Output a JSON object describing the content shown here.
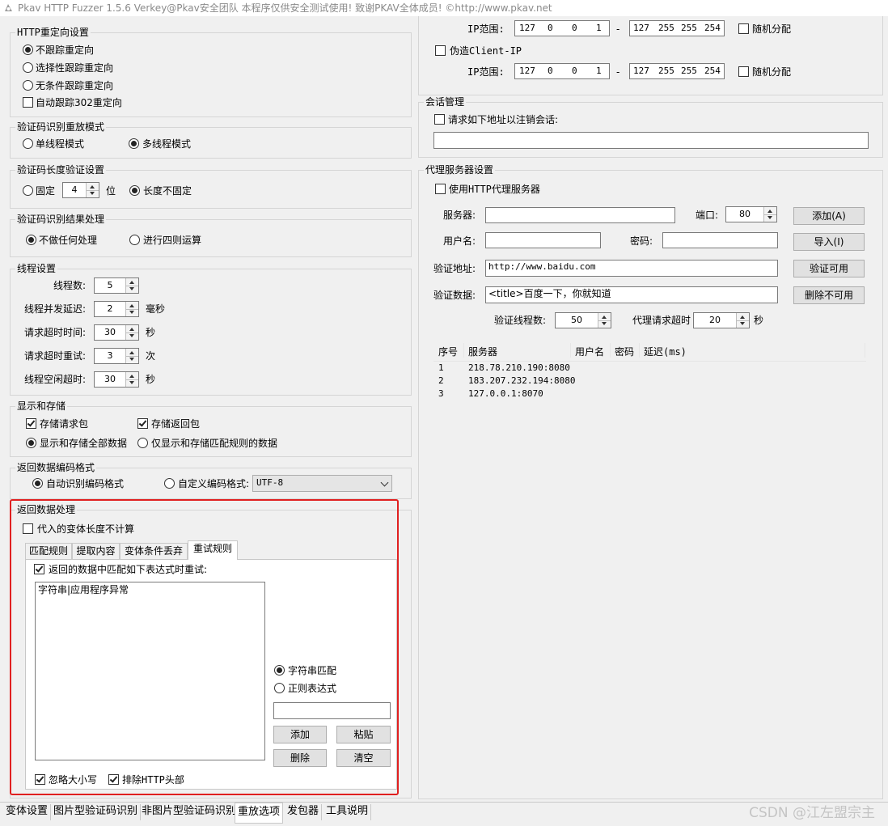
{
  "title_bar": {
    "text": "Pkav HTTP Fuzzer 1.5.6  Verkey@Pkav安全团队  本程序仅供安全测试使用! 致谢PKAV全体成员! ©http://www.pkav.net"
  },
  "redirect": {
    "group_label": "HTTP重定向设置",
    "options": [
      "不跟踪重定向",
      "选择性跟踪重定向",
      "无条件跟踪重定向"
    ],
    "auto302": "自动跟踪302重定向"
  },
  "captcha_replay": {
    "group_label": "验证码识别重放模式",
    "single": "单线程模式",
    "multi": "多线程模式"
  },
  "captcha_length": {
    "group_label": "验证码长度验证设置",
    "fixed": "固定",
    "value": "4",
    "unit": "位",
    "variable": "长度不固定"
  },
  "captcha_result": {
    "group_label": "验证码识别结果处理",
    "none": "不做任何处理",
    "arith": "进行四则运算"
  },
  "threads": {
    "group_label": "线程设置",
    "rows": [
      {
        "label": "线程数:",
        "value": "5",
        "unit": ""
      },
      {
        "label": "线程并发延迟:",
        "value": "2",
        "unit": "毫秒"
      },
      {
        "label": "请求超时时间:",
        "value": "30",
        "unit": "秒"
      },
      {
        "label": "请求超时重试:",
        "value": "3",
        "unit": "次"
      },
      {
        "label": "线程空闲超时:",
        "value": "30",
        "unit": "秒"
      }
    ]
  },
  "display": {
    "group_label": "显示和存储",
    "store_req": "存储请求包",
    "store_resp": "存储返回包",
    "show_all": "显示和存储全部数据",
    "show_match": "仅显示和存储匹配规则的数据"
  },
  "encoding": {
    "group_label": "返回数据编码格式",
    "auto": "自动识别编码格式",
    "custom": "自定义编码格式:",
    "selected": "UTF-8"
  },
  "response": {
    "group_label": "返回数据处理",
    "ignore_len": "代入的变体长度不计算",
    "tabs": [
      "匹配规则",
      "提取内容",
      "变体条件丢弃",
      "重试规则"
    ],
    "retry_check": "返回的数据中匹配如下表达式时重试:",
    "list_item": "字符串|应用程序异常",
    "mode_string": "字符串匹配",
    "mode_regex": "正则表达式",
    "input_value": "",
    "btn_add": "添加",
    "btn_paste": "粘贴",
    "btn_delete": "删除",
    "btn_clear": "清空",
    "ignore_case": "忽略大小写",
    "exclude_header": "排除HTTP头部"
  },
  "ip": {
    "label": "IP范围:",
    "row1": {
      "from": [
        "127",
        "0",
        "0",
        "1"
      ],
      "to": [
        "127",
        "255",
        "255",
        "254"
      ]
    },
    "row2": {
      "from": [
        "127",
        "0",
        "0",
        "1"
      ],
      "to": [
        "127",
        "255",
        "255",
        "254"
      ]
    },
    "random": "随机分配",
    "dash": "-",
    "fake_client": "伪造Client-IP"
  },
  "session": {
    "group_label": "会话管理",
    "logout": "请求如下地址以注销会话:",
    "url": ""
  },
  "proxy": {
    "group_label": "代理服务器设置",
    "use": "使用HTTP代理服务器",
    "server_label": "服务器:",
    "server": "",
    "port_label": "端口:",
    "port": "80",
    "user_label": "用户名:",
    "user": "",
    "pass_label": "密码:",
    "pass": "",
    "verify_url_label": "验证地址:",
    "verify_url": "http://www.baidu.com",
    "verify_data_label": "验证数据:",
    "verify_data": "<title>百度一下，你就知道",
    "verify_threads_label": "验证线程数:",
    "verify_threads": "50",
    "timeout_label": "代理请求超时",
    "timeout": "20",
    "timeout_unit": "秒",
    "btn_add": "添加(A)",
    "btn_import": "导入(I)",
    "btn_valid": "验证可用",
    "btn_del_invalid": "删除不可用",
    "columns": [
      "序号",
      "服务器",
      "用户名",
      "密码",
      "延迟(ms)"
    ],
    "rows": [
      {
        "no": "1",
        "server": "218.78.210.190:8080"
      },
      {
        "no": "2",
        "server": "183.207.232.194:8080"
      },
      {
        "no": "3",
        "server": "127.0.0.1:8070"
      }
    ]
  },
  "bottom_tabs": [
    "变体设置",
    "图片型验证码识别",
    "非图片型验证码识别",
    "重放选项",
    "发包器",
    "工具说明"
  ],
  "watermark": "CSDN @江左盟宗主",
  "colors": {
    "highlight_border": "#e02020"
  }
}
